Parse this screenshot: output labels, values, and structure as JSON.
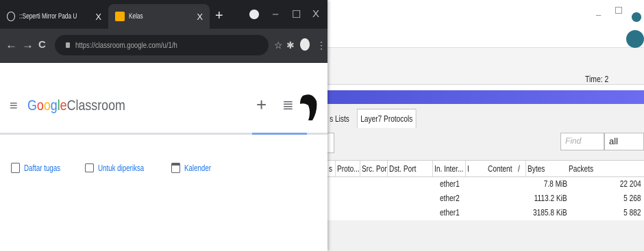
{
  "browser": {
    "tabs": [
      {
        "title": "::Seperti Mirror Pada Umum",
        "active": false
      },
      {
        "title": "Kelas",
        "active": true
      }
    ],
    "url": "https://classroom.google.com/u/1/h",
    "new_tab_symbol": "+",
    "window_controls": {
      "minimize": "–",
      "maximize": "☐",
      "close": "X"
    },
    "nav": {
      "back": "←",
      "forward": "→",
      "reload": "C"
    }
  },
  "classroom": {
    "logo_google": "Google",
    "logo_classroom": "Classroom",
    "logo_colors": [
      "#4285f4",
      "#ea4335",
      "#fbbc05",
      "#4285f4",
      "#34a853",
      "#ea4335"
    ],
    "plus": "+",
    "nav_items": [
      {
        "label": "Daftar tugas",
        "icon": "assignment-icon"
      },
      {
        "label": "Untuk diperiksa",
        "icon": "review-icon"
      },
      {
        "label": "Kalender",
        "icon": "calendar-icon"
      }
    ]
  },
  "winbox": {
    "minimize": "–",
    "time_label": "Time: 2",
    "tabs": [
      "s Lists",
      "Layer7 Protocols"
    ],
    "find_placeholder": "Find",
    "filter_value": "all",
    "columns": [
      "s",
      "Proto...",
      "Src. Port",
      "Dst. Port",
      "In. Inter...",
      "I",
      "Content",
      "/",
      "Bytes",
      "Packets"
    ],
    "rows": [
      {
        "in_interface": "ether1",
        "bytes": "7.8 MiB",
        "packets": "22 204"
      },
      {
        "in_interface": "ether2",
        "bytes": "1113.2 KiB",
        "packets": "5 268"
      },
      {
        "in_interface": "ether1",
        "bytes": "3185.8 KiB",
        "packets": "5 882"
      }
    ],
    "accent": "#5a5fe0"
  }
}
